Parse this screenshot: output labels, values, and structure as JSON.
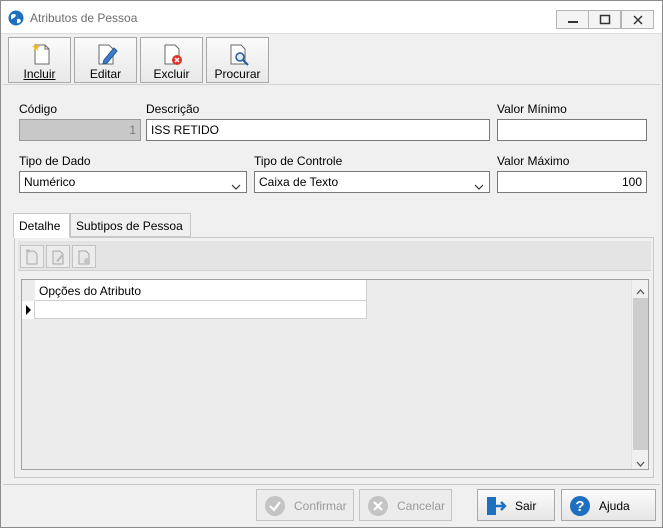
{
  "window": {
    "title": "Atributos de Pessoa"
  },
  "toolbar": {
    "incluir": "Incluir",
    "editar": "Editar",
    "excluir": "Excluir",
    "procurar": "Procurar"
  },
  "form": {
    "codigo_label": "Código",
    "codigo_value": "1",
    "descricao_label": "Descrição",
    "descricao_value": "ISS RETIDO",
    "valor_minimo_label": "Valor Mínimo",
    "valor_minimo_value": "",
    "tipo_dado_label": "Tipo de Dado",
    "tipo_dado_value": "Numérico",
    "tipo_controle_label": "Tipo de Controle",
    "tipo_controle_value": "Caixa de Texto",
    "valor_maximo_label": "Valor Máximo",
    "valor_maximo_value": "100"
  },
  "tabs": [
    {
      "label": "Detalhe",
      "active": true
    },
    {
      "label": "Subtipos de Pessoa",
      "active": false
    }
  ],
  "grid": {
    "columns": [
      "Opções do Atributo"
    ],
    "rows": [
      [
        ""
      ]
    ]
  },
  "bottom": {
    "confirmar": "Confirmar",
    "cancelar": "Cancelar",
    "sair": "Sair",
    "ajuda": "Ajuda"
  },
  "colors": {
    "accent_blue": "#1e6fbf",
    "delete_red": "#d9342b",
    "disabled_field": "#c8c8c8"
  },
  "icons": [
    "globe-icon",
    "minimize-icon",
    "maximize-icon",
    "close-icon",
    "new-document-icon",
    "edit-document-icon",
    "delete-document-icon",
    "search-document-icon",
    "confirm-check-icon",
    "cancel-x-icon",
    "exit-door-icon",
    "help-question-icon"
  ]
}
